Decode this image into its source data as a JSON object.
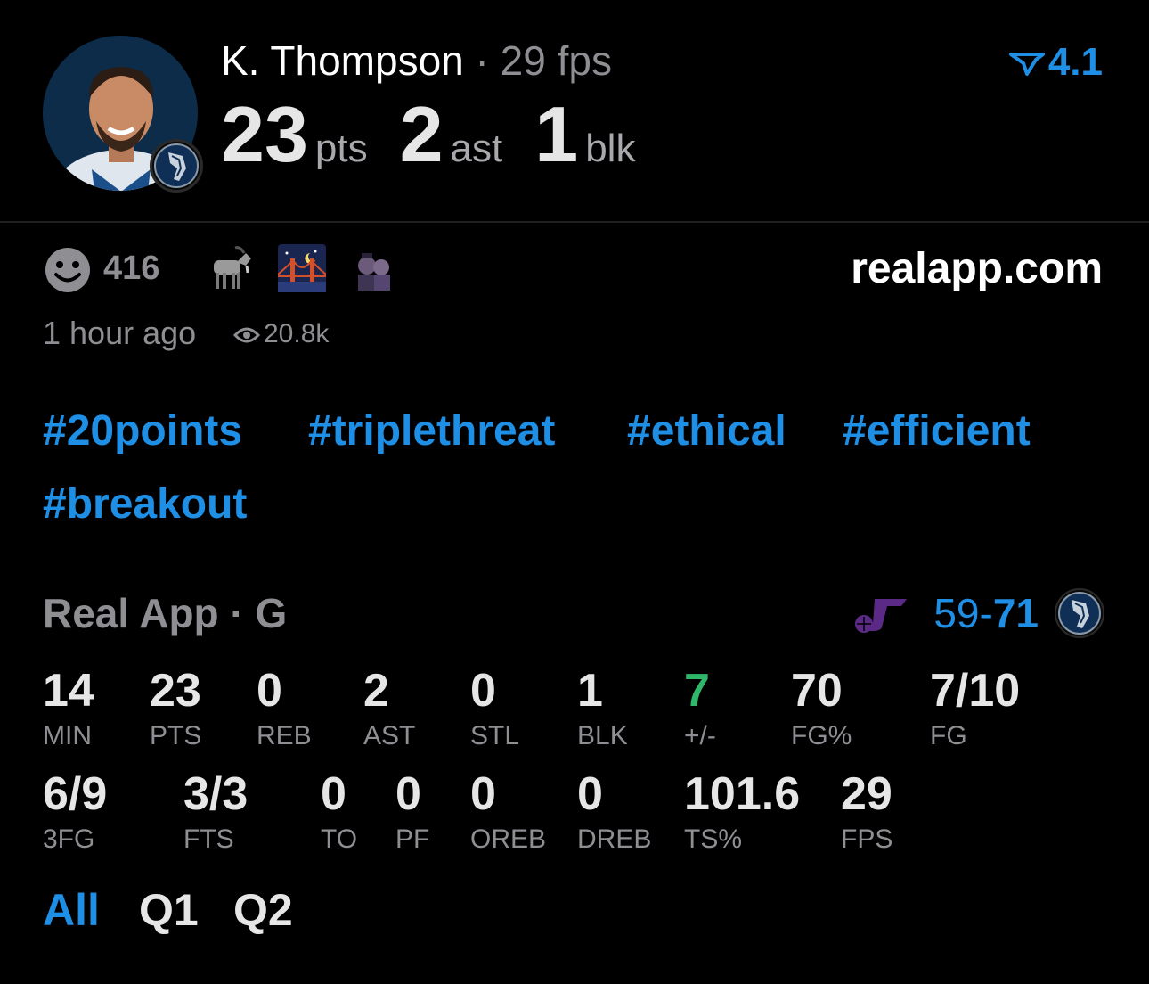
{
  "header": {
    "player_name": "K. Thompson",
    "separator": " · ",
    "fps_text": "29 fps",
    "stats": [
      {
        "value": "23",
        "unit": "pts"
      },
      {
        "value": "2",
        "unit": "ast"
      },
      {
        "value": "1",
        "unit": "blk"
      }
    ],
    "rating": "4.1"
  },
  "social": {
    "reaction_count": "416",
    "site": "realapp.com",
    "time_ago": "1 hour ago",
    "views": "20.8k",
    "icons": [
      "smiley-icon",
      "goat-emoji",
      "golden-gate-bridge-emoji",
      "toy-story-emoji",
      "eye-icon"
    ]
  },
  "hashtags": [
    "#20points",
    "#triplethreat",
    "#ethical",
    "#efficient",
    "#breakout"
  ],
  "game": {
    "league_text": "Real App · G",
    "score_away": "59",
    "score_dash": "-",
    "score_home": "71"
  },
  "stats_row1": [
    {
      "value": "14",
      "label": "MIN"
    },
    {
      "value": "23",
      "label": "PTS"
    },
    {
      "value": "0",
      "label": "REB"
    },
    {
      "value": "2",
      "label": "AST"
    },
    {
      "value": "0",
      "label": "STL"
    },
    {
      "value": "1",
      "label": "BLK"
    },
    {
      "value": "7",
      "label": "+/-"
    },
    {
      "value": "70",
      "label": "FG%"
    },
    {
      "value": "7/10",
      "label": "FG"
    }
  ],
  "stats_row2": [
    {
      "value": "6/9",
      "label": "3FG"
    },
    {
      "value": "3/3",
      "label": "FTS"
    },
    {
      "value": "0",
      "label": "TO"
    },
    {
      "value": "0",
      "label": "PF"
    },
    {
      "value": "0",
      "label": "OREB"
    },
    {
      "value": "0",
      "label": "DREB"
    },
    {
      "value": "101.6",
      "label": "TS%"
    },
    {
      "value": "29",
      "label": "FPS"
    }
  ],
  "tabs": [
    {
      "label": "All",
      "active": true
    },
    {
      "label": "Q1",
      "active": false
    },
    {
      "label": "Q2",
      "active": false
    }
  ],
  "colors": {
    "accent": "#1e8fe5",
    "positive": "#2fb86a",
    "muted": "#8e8e93",
    "jazz_purple": "#5b2a86"
  }
}
